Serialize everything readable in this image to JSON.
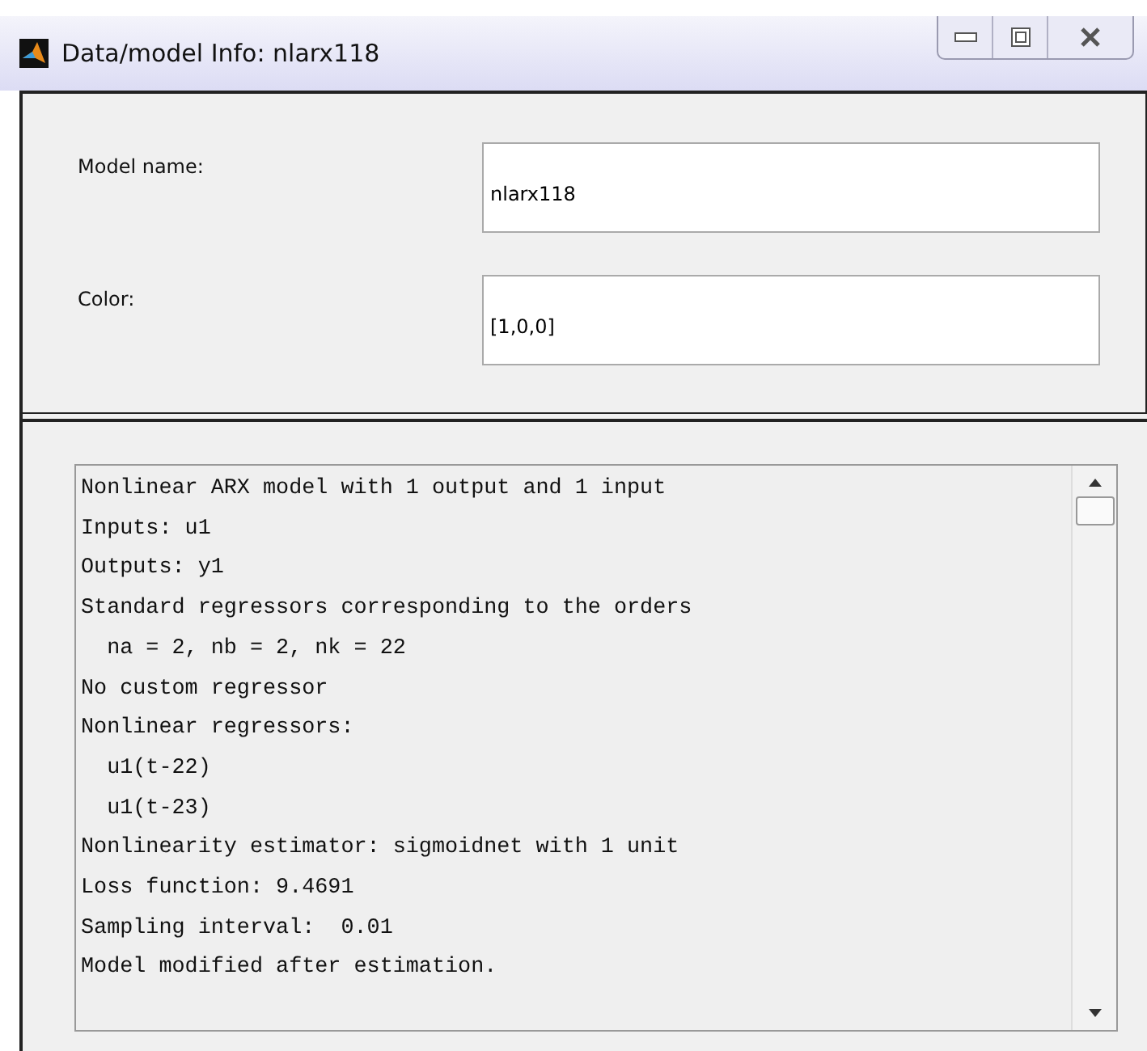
{
  "window": {
    "title": "Data/model Info: nlarx118"
  },
  "fields": [
    {
      "label": "Model name:",
      "value": "nlarx118"
    },
    {
      "label": "Color:",
      "value": "[1,0,0]"
    }
  ],
  "info_text": [
    "Nonlinear ARX model with 1 output and 1 input",
    "Inputs: u1",
    "Outputs: y1",
    "Standard regressors corresponding to the orders",
    "  na = 2, nb = 2, nk = 22",
    "No custom regressor",
    "Nonlinear regressors:",
    "  u1(t-22)",
    "  u1(t-23)",
    "Nonlinearity estimator: sigmoidnet with 1 unit",
    "Loss function: 9.4691",
    "Sampling interval:  0.01",
    "Model modified after estimation."
  ]
}
